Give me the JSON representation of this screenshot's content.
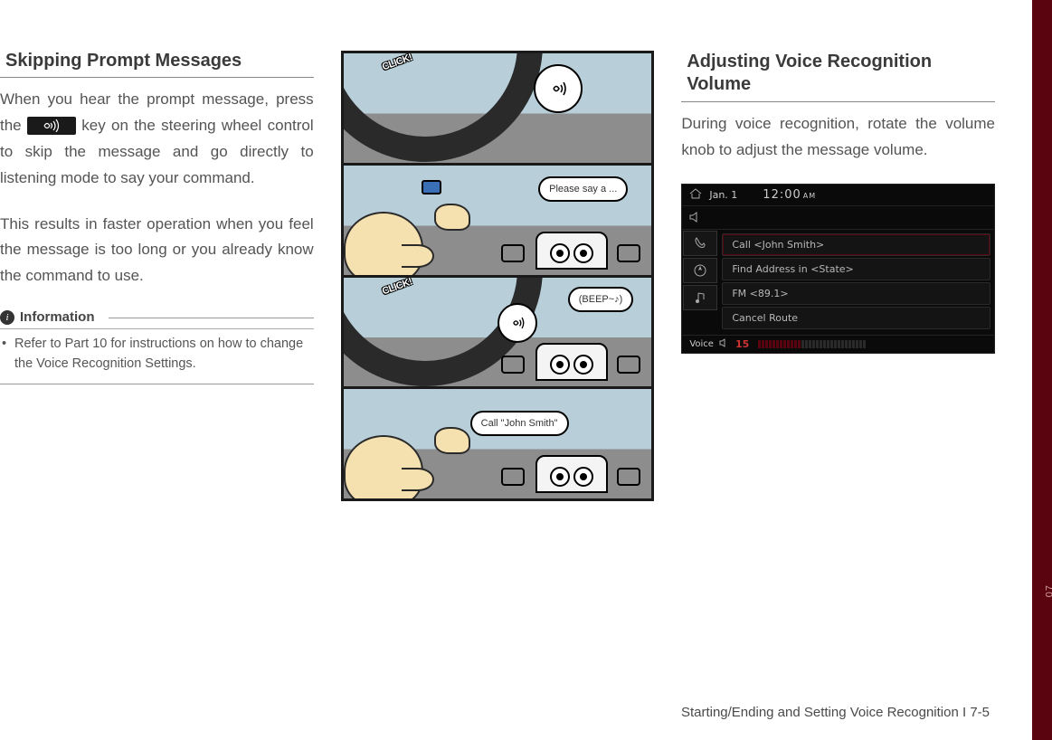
{
  "sideTab": "07",
  "col1": {
    "heading": "Skipping Prompt Messages",
    "p1a": "When you hear the prompt message, press the ",
    "p1b": " key on the steering wheel control to skip the message and go directly to listening mode to say your command.",
    "p2": "This results in faster operation when you feel the message is too long or you already know the command to use.",
    "infoLabel": "Information",
    "infoBullet": "Refer to Part 10 for instructions on how to change the Voice Recognition Settings."
  },
  "comic": {
    "click": "CLICK!",
    "bubble2": "Please say a ...",
    "bubble3": "(BEEP~♪)",
    "bubble4": "Call \"John Smith\""
  },
  "col3": {
    "heading": "Adjusting Voice Recognition Volume",
    "p1": "During voice recognition, rotate the volume knob to adjust the message volume."
  },
  "infoscreen": {
    "date": "Jan. 1",
    "time": "12:00",
    "ampm": "AM",
    "rows": [
      "Call <John Smith>",
      "Find Address in <State>",
      "FM <89.1>",
      "Cancel Route"
    ],
    "footLabel": "Voice",
    "volNum": "15"
  },
  "footer": "Starting/Ending and Setting Voice Recognition I 7-5"
}
